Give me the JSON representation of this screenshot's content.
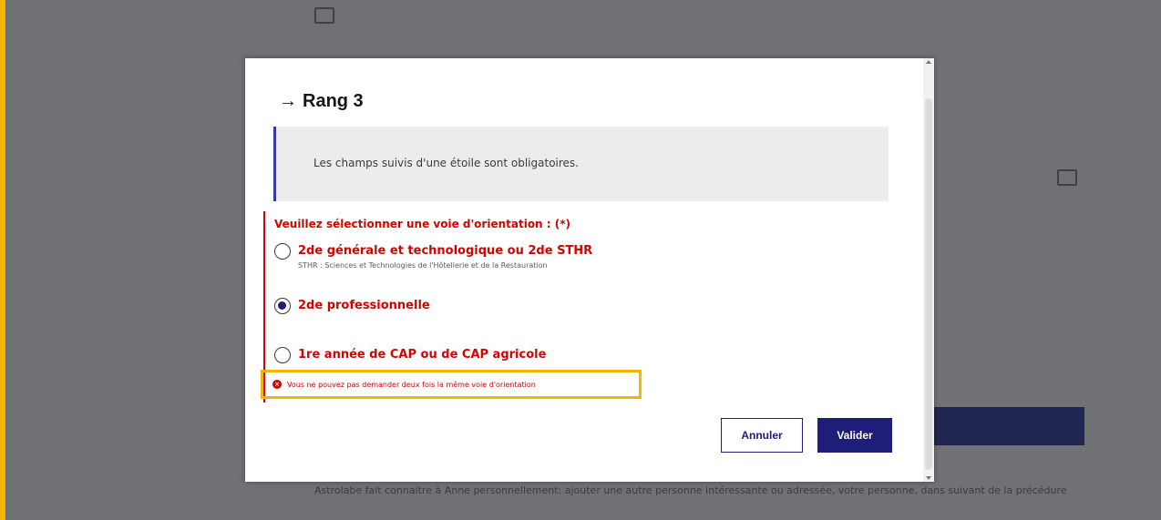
{
  "background": {
    "footer_text": "Astrolabe fait connaitre à Anne personnellement: ajouter une autre personne intéressante ou adressée, votre personne, dans suivant de la précédure"
  },
  "modal": {
    "title": "Rang 3",
    "notice": "Les champs suivis d'une étoile sont obligatoires.",
    "legend": "Veuillez sélectionner une voie d'orientation : (*)",
    "options": [
      {
        "label": "2de générale et technologique ou 2de STHR",
        "hint": "STHR : Sciences et Technologies de l'Hôtellerie et de la Restauration",
        "checked": false
      },
      {
        "label": "2de professionnelle",
        "hint": "",
        "checked": true
      },
      {
        "label": "1re année de CAP ou de CAP agricole",
        "hint": "",
        "checked": false
      }
    ],
    "error": "Vous ne pouvez pas demander deux fois la même voie d'orientation",
    "buttons": {
      "cancel": "Annuler",
      "validate": "Valider"
    }
  },
  "colors": {
    "error_red": "#ce0500",
    "primary_blue": "#1e1e78",
    "highlight_yellow": "#f2b705",
    "overlay_grey": "#6f7175"
  },
  "icons": {
    "title_arrow": "arrow-right-icon",
    "error": "error-circle-icon"
  }
}
